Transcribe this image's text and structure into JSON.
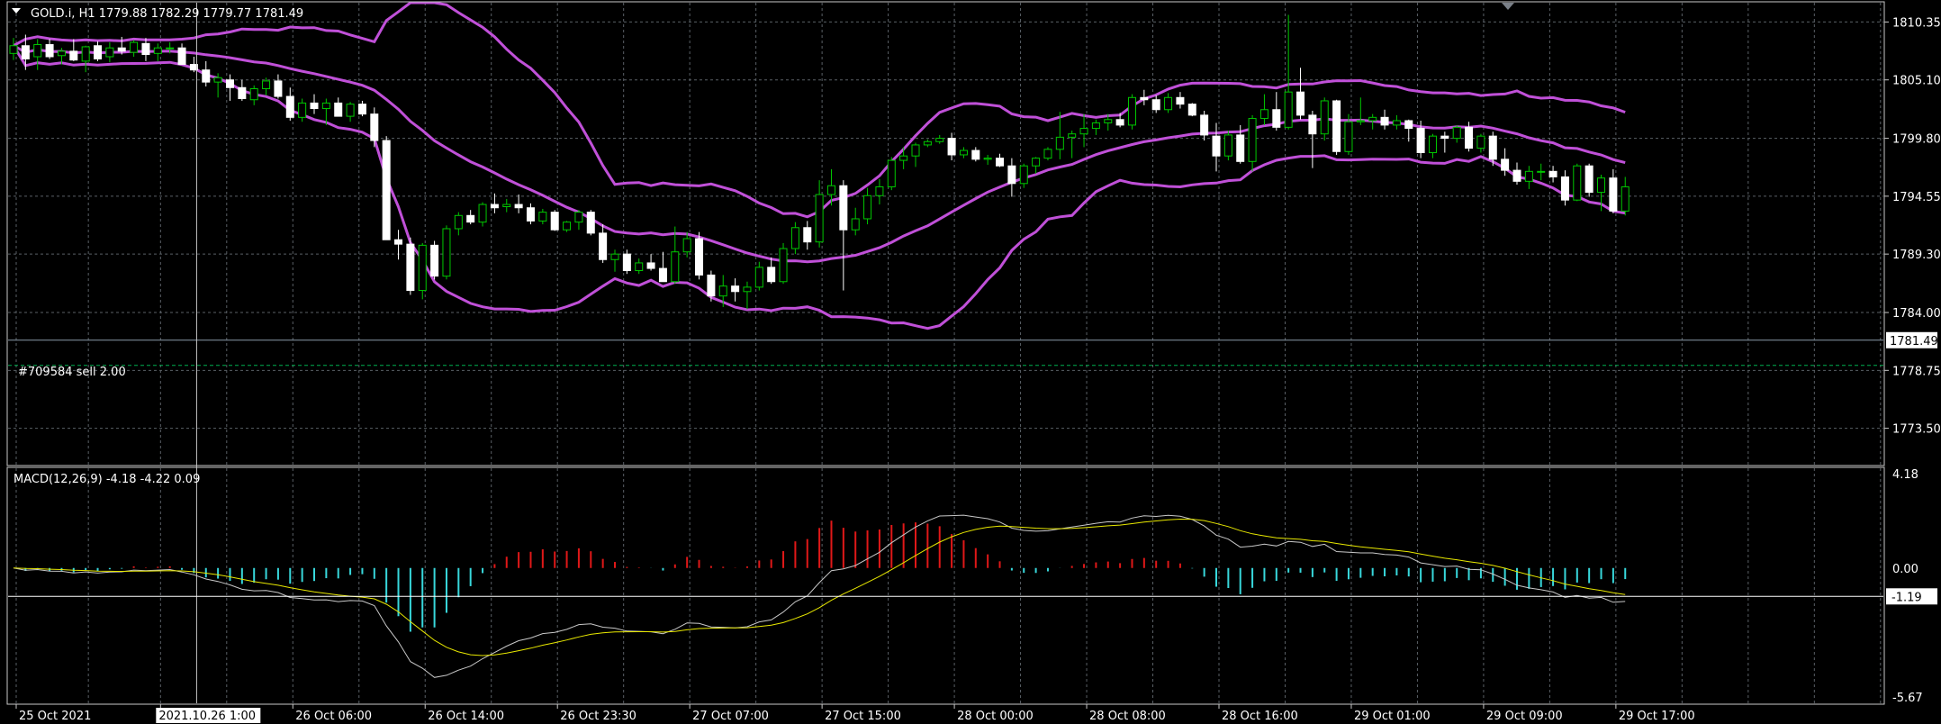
{
  "header": {
    "symbol_line": "GOLD.i, H1  1779.88 1782.29 1779.77 1781.49",
    "macd_line": "MACD(12,26,9) -4.18 -4.22 0.09",
    "order_label": "#709584 sell 2.00"
  },
  "colors": {
    "background": "#000000",
    "grid": "#5a6066",
    "frame": "#c8c8c8",
    "axis_text": "#ffffff",
    "bull_body": "#000000",
    "bull_wick": "#00c800",
    "bear_body": "#ffffff",
    "bollinger": "#c050d8",
    "macd_hist_pos": "#e01818",
    "macd_hist_neg": "#38d8dc",
    "macd_line": "#c8c8c8",
    "signal_line": "#e8e800",
    "price_line": "#8a9aa8",
    "order_line": "#00b050",
    "crosshair": "#c8c8c8"
  },
  "chart_data": [
    {
      "type": "candlestick",
      "title": "GOLD.i, H1  1779.88 1782.29 1779.77 1781.49",
      "ylim": [
        1770.2,
        1812.1
      ],
      "y_ticks": [
        "1810.35",
        "1805.10",
        "1799.80",
        "1794.55",
        "1789.30",
        "1784.00",
        "1778.75",
        "1773.50"
      ],
      "x_ticks": [
        "25 Oct 2021",
        "2021.10.26 1:00",
        "26 Oct 06:00",
        "26 Oct 14:00",
        "26 Oct 23:30",
        "27 Oct 07:00",
        "27 Oct 15:00",
        "28 Oct 00:00",
        "28 Oct 08:00",
        "28 Oct 16:00",
        "29 Oct 01:00",
        "29 Oct 09:00",
        "29 Oct 17:00"
      ],
      "x_tick_index": [
        0,
        12,
        23,
        34,
        45,
        56,
        67,
        78,
        89,
        100,
        111,
        122,
        133
      ],
      "current_price": "1781.49",
      "order_price": 1779.2,
      "crosshair_index": 15,
      "crosshair_label": "2021.10.26 1:00",
      "candles": [
        [
          1807.5,
          1808.9,
          1806.9,
          1808.2
        ],
        [
          1808.2,
          1809.2,
          1806.0,
          1807.0
        ],
        [
          1807.2,
          1808.8,
          1806.0,
          1808.3
        ],
        [
          1808.3,
          1808.8,
          1807.0,
          1807.2
        ],
        [
          1807.3,
          1808.0,
          1806.5,
          1807.7
        ],
        [
          1807.7,
          1808.8,
          1806.8,
          1806.9
        ],
        [
          1806.8,
          1808.2,
          1805.8,
          1808.1
        ],
        [
          1808.2,
          1808.6,
          1806.8,
          1807.0
        ],
        [
          1807.2,
          1808.5,
          1806.7,
          1808.0
        ],
        [
          1808.0,
          1809.0,
          1807.4,
          1807.7
        ],
        [
          1807.6,
          1808.7,
          1807.2,
          1808.5
        ],
        [
          1808.4,
          1808.9,
          1806.8,
          1807.4
        ],
        [
          1807.5,
          1808.4,
          1806.8,
          1808.0
        ],
        [
          1808.0,
          1808.5,
          1807.5,
          1808.0
        ],
        [
          1808.0,
          1808.4,
          1806.5,
          1806.5
        ],
        [
          1806.5,
          1807.2,
          1805.8,
          1806.0
        ],
        [
          1806.0,
          1806.8,
          1804.5,
          1804.9
        ],
        [
          1804.9,
          1805.7,
          1803.5,
          1805.3
        ],
        [
          1805.1,
          1805.6,
          1803.2,
          1804.4
        ],
        [
          1804.4,
          1805.1,
          1803.2,
          1803.4
        ],
        [
          1803.3,
          1804.6,
          1802.8,
          1804.3
        ],
        [
          1804.3,
          1805.3,
          1803.7,
          1805.0
        ],
        [
          1805.0,
          1805.6,
          1803.4,
          1803.6
        ],
        [
          1803.6,
          1804.4,
          1801.4,
          1801.7
        ],
        [
          1801.7,
          1803.4,
          1801.3,
          1803.0
        ],
        [
          1803.0,
          1803.8,
          1802.0,
          1802.5
        ],
        [
          1802.5,
          1803.4,
          1801.0,
          1803.0
        ],
        [
          1803.0,
          1803.5,
          1801.8,
          1801.8
        ],
        [
          1801.8,
          1803.1,
          1801.3,
          1802.9
        ],
        [
          1802.9,
          1803.2,
          1801.8,
          1802.0
        ],
        [
          1802.0,
          1802.6,
          1799.0,
          1799.6
        ],
        [
          1799.6,
          1800.0,
          1792.5,
          1790.6
        ],
        [
          1790.6,
          1791.5,
          1788.8,
          1790.2
        ],
        [
          1790.2,
          1790.8,
          1785.6,
          1786.0
        ],
        [
          1786.0,
          1790.3,
          1785.2,
          1790.1
        ],
        [
          1790.1,
          1790.5,
          1787.0,
          1787.3
        ],
        [
          1787.3,
          1791.9,
          1787.0,
          1791.6
        ],
        [
          1791.6,
          1793.1,
          1791.0,
          1792.8
        ],
        [
          1792.8,
          1793.3,
          1792.0,
          1792.2
        ],
        [
          1792.2,
          1794.0,
          1791.8,
          1793.8
        ],
        [
          1793.8,
          1794.8,
          1793.0,
          1793.5
        ],
        [
          1793.6,
          1794.3,
          1793.1,
          1793.8
        ],
        [
          1793.8,
          1794.7,
          1793.0,
          1793.5
        ],
        [
          1793.5,
          1793.9,
          1792.0,
          1792.3
        ],
        [
          1792.3,
          1793.4,
          1792.0,
          1793.1
        ],
        [
          1793.1,
          1793.3,
          1791.4,
          1791.5
        ],
        [
          1791.5,
          1792.3,
          1791.3,
          1792.2
        ],
        [
          1792.2,
          1793.3,
          1791.5,
          1793.1
        ],
        [
          1793.1,
          1793.3,
          1791.0,
          1791.2
        ],
        [
          1791.2,
          1792.0,
          1788.5,
          1788.8
        ],
        [
          1788.8,
          1789.7,
          1787.7,
          1789.3
        ],
        [
          1789.3,
          1789.7,
          1787.5,
          1787.8
        ],
        [
          1787.8,
          1788.9,
          1787.5,
          1788.5
        ],
        [
          1788.5,
          1789.3,
          1787.8,
          1788.0
        ],
        [
          1788.0,
          1789.5,
          1786.8,
          1786.8
        ],
        [
          1786.8,
          1791.8,
          1786.6,
          1789.5
        ],
        [
          1789.5,
          1791.3,
          1789.0,
          1790.7
        ],
        [
          1790.7,
          1791.3,
          1787.0,
          1787.4
        ],
        [
          1787.4,
          1787.8,
          1785.0,
          1785.5
        ],
        [
          1785.5,
          1787.4,
          1784.5,
          1786.4
        ],
        [
          1786.4,
          1787.1,
          1785.0,
          1785.9
        ],
        [
          1785.9,
          1786.8,
          1784.3,
          1786.3
        ],
        [
          1786.3,
          1788.6,
          1786.0,
          1788.1
        ],
        [
          1788.1,
          1789.0,
          1786.6,
          1786.8
        ],
        [
          1786.8,
          1790.3,
          1786.6,
          1789.8
        ],
        [
          1789.8,
          1792.2,
          1789.3,
          1791.7
        ],
        [
          1791.7,
          1792.3,
          1789.7,
          1790.4
        ],
        [
          1790.4,
          1796.0,
          1789.9,
          1794.7
        ],
        [
          1794.7,
          1797.0,
          1793.7,
          1795.5
        ],
        [
          1795.5,
          1796.0,
          1786.0,
          1791.5
        ],
        [
          1791.5,
          1793.5,
          1791.0,
          1792.5
        ],
        [
          1792.5,
          1795.3,
          1792.0,
          1794.6
        ],
        [
          1794.6,
          1796.1,
          1793.8,
          1795.4
        ],
        [
          1795.4,
          1798.1,
          1795.1,
          1797.8
        ],
        [
          1797.8,
          1799.0,
          1797.0,
          1798.2
        ],
        [
          1798.2,
          1799.4,
          1797.2,
          1799.2
        ],
        [
          1799.2,
          1799.7,
          1799.0,
          1799.5
        ],
        [
          1799.5,
          1800.1,
          1799.3,
          1799.8
        ],
        [
          1799.8,
          1800.3,
          1797.8,
          1798.3
        ],
        [
          1798.3,
          1799.0,
          1798.0,
          1798.7
        ],
        [
          1798.7,
          1799.0,
          1797.7,
          1797.9
        ],
        [
          1797.9,
          1798.3,
          1797.4,
          1798.0
        ],
        [
          1798.0,
          1798.4,
          1797.2,
          1797.3
        ],
        [
          1797.3,
          1798.0,
          1794.5,
          1795.7
        ],
        [
          1795.7,
          1797.5,
          1795.3,
          1797.3
        ],
        [
          1797.3,
          1798.1,
          1796.6,
          1798.0
        ],
        [
          1798.0,
          1799.0,
          1797.8,
          1798.8
        ],
        [
          1798.8,
          1802.2,
          1797.9,
          1799.9
        ],
        [
          1799.9,
          1800.5,
          1798.0,
          1800.2
        ],
        [
          1800.2,
          1802.0,
          1799.0,
          1800.7
        ],
        [
          1800.7,
          1801.5,
          1800.1,
          1801.2
        ],
        [
          1801.2,
          1802.0,
          1800.5,
          1801.5
        ],
        [
          1801.5,
          1802.1,
          1800.8,
          1801.0
        ],
        [
          1801.0,
          1803.8,
          1800.6,
          1803.5
        ],
        [
          1803.5,
          1804.2,
          1802.8,
          1803.3
        ],
        [
          1803.3,
          1803.7,
          1802.1,
          1802.4
        ],
        [
          1802.4,
          1803.9,
          1802.1,
          1803.5
        ],
        [
          1803.5,
          1804.0,
          1802.5,
          1802.9
        ],
        [
          1802.9,
          1803.0,
          1801.8,
          1801.9
        ],
        [
          1801.9,
          1802.3,
          1799.6,
          1800.1
        ],
        [
          1800.0,
          1801.2,
          1796.8,
          1798.2
        ],
        [
          1798.2,
          1800.5,
          1797.8,
          1800.1
        ],
        [
          1800.1,
          1801.0,
          1797.5,
          1797.7
        ],
        [
          1797.7,
          1801.9,
          1796.8,
          1801.6
        ],
        [
          1801.6,
          1803.8,
          1801.0,
          1802.4
        ],
        [
          1802.4,
          1804.0,
          1800.5,
          1800.8
        ],
        [
          1800.8,
          1811.0,
          1800.6,
          1804.0
        ],
        [
          1804.0,
          1806.2,
          1801.5,
          1801.9
        ],
        [
          1801.9,
          1802.3,
          1797.1,
          1800.2
        ],
        [
          1800.2,
          1803.5,
          1799.6,
          1803.2
        ],
        [
          1803.2,
          1803.3,
          1798.3,
          1798.6
        ],
        [
          1798.6,
          1802.0,
          1798.3,
          1801.3
        ],
        [
          1801.3,
          1803.5,
          1801.0,
          1801.4
        ],
        [
          1801.4,
          1802.0,
          1800.6,
          1801.7
        ],
        [
          1801.7,
          1802.4,
          1800.6,
          1801.0
        ],
        [
          1801.0,
          1801.9,
          1800.6,
          1801.4
        ],
        [
          1801.4,
          1801.5,
          1799.5,
          1800.7
        ],
        [
          1800.7,
          1801.4,
          1798.0,
          1798.5
        ],
        [
          1798.5,
          1800.2,
          1798.0,
          1800.0
        ],
        [
          1800.0,
          1800.4,
          1798.5,
          1799.8
        ],
        [
          1799.8,
          1801.0,
          1799.4,
          1800.8
        ],
        [
          1800.8,
          1801.3,
          1798.6,
          1798.9
        ],
        [
          1798.9,
          1800.2,
          1798.5,
          1800.0
        ],
        [
          1800.0,
          1800.4,
          1797.3,
          1797.9
        ],
        [
          1797.9,
          1798.9,
          1796.4,
          1796.9
        ],
        [
          1796.9,
          1797.6,
          1795.6,
          1795.9
        ],
        [
          1795.9,
          1797.3,
          1795.2,
          1796.8
        ],
        [
          1796.8,
          1797.5,
          1796.0,
          1796.8
        ],
        [
          1796.8,
          1797.3,
          1795.8,
          1796.3
        ],
        [
          1796.3,
          1796.9,
          1793.7,
          1794.2
        ],
        [
          1794.2,
          1797.5,
          1794.1,
          1797.3
        ],
        [
          1797.3,
          1797.5,
          1794.5,
          1794.9
        ],
        [
          1794.9,
          1796.5,
          1793.2,
          1796.2
        ],
        [
          1796.2,
          1797.0,
          1793.0,
          1793.2
        ],
        [
          1793.2,
          1796.3,
          1792.8,
          1795.4
        ]
      ]
    },
    {
      "type": "line",
      "title": "MACD(12,26,9) -4.18 -4.22 0.09",
      "ylim": [
        -5.67,
        4.18
      ],
      "y_ticks": [
        "4.18",
        "0.00",
        "-5.67"
      ],
      "hline_value": -1.19,
      "hline_label": "-1.19",
      "series": []
    }
  ]
}
